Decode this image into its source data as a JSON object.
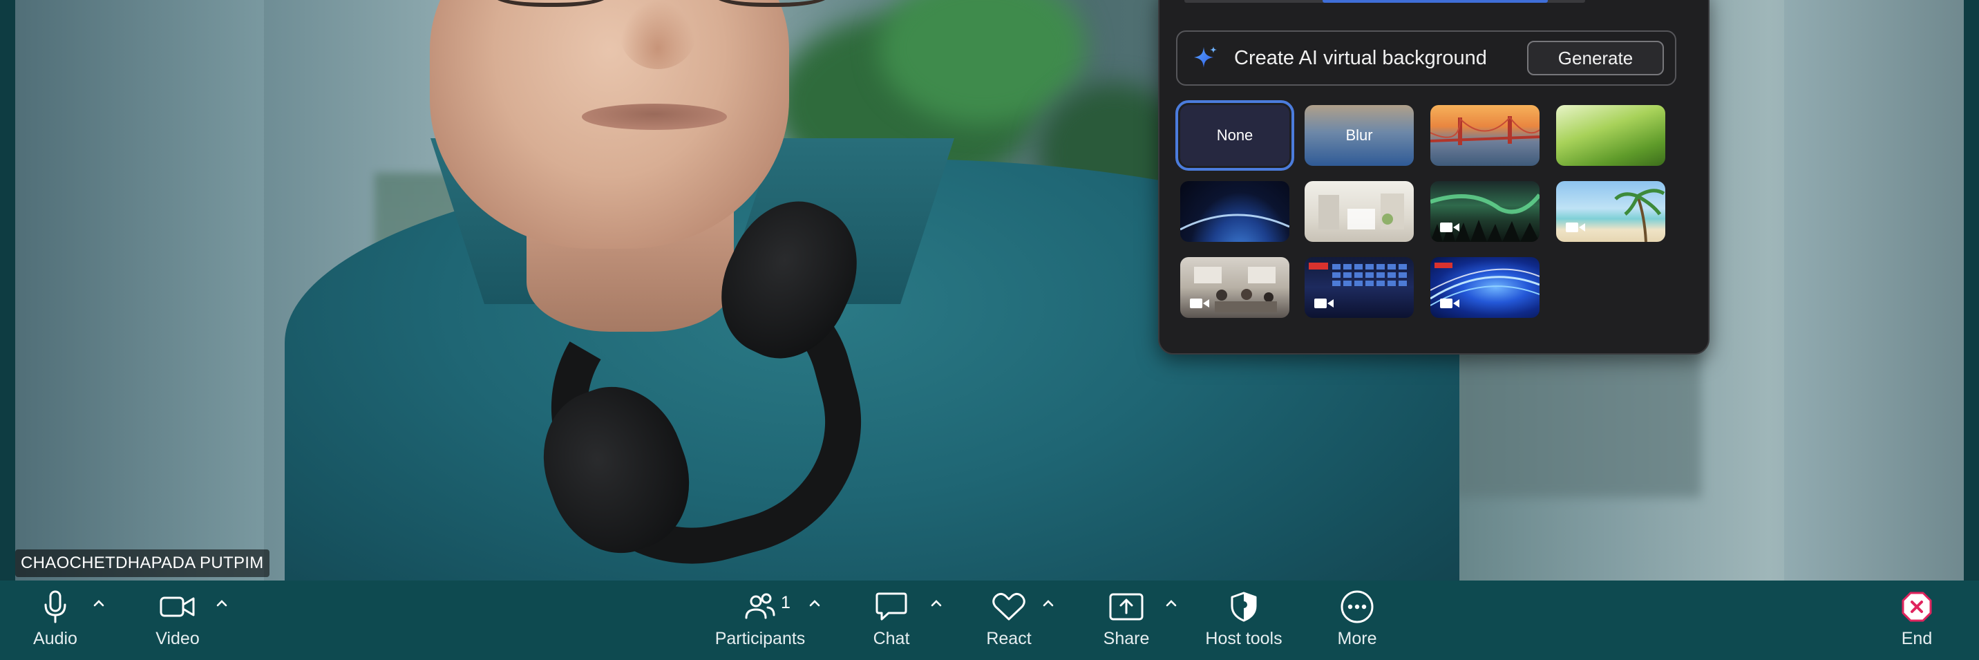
{
  "video": {
    "participant_name": "CHAOCHETDHAPADA PUTPIM"
  },
  "virtual_background_panel": {
    "ai_label": "Create AI virtual background",
    "generate_label": "Generate",
    "thumbnails": [
      {
        "label": "None",
        "selected": true
      },
      {
        "label": "Blur",
        "selected": false
      },
      {
        "label": "",
        "scene": "golden-gate-bridge"
      },
      {
        "label": "",
        "scene": "grass"
      },
      {
        "label": "",
        "scene": "earth-from-space"
      },
      {
        "label": "",
        "scene": "white-office"
      },
      {
        "label": "",
        "scene": "aurora",
        "video": true
      },
      {
        "label": "",
        "scene": "beach-palm",
        "video": true
      },
      {
        "label": "",
        "scene": "meeting-room",
        "video": true
      },
      {
        "label": "",
        "scene": "news-studio",
        "video": true
      },
      {
        "label": "",
        "scene": "blue-light-streaks",
        "video": true
      }
    ]
  },
  "toolbar": {
    "audio": "Audio",
    "video": "Video",
    "participants": "Participants",
    "participants_count": "1",
    "chat": "Chat",
    "react": "React",
    "share": "Share",
    "host_tools": "Host tools",
    "more": "More",
    "end": "End"
  },
  "colors": {
    "toolbar_bg": "#0e4a50",
    "panel_bg": "#1f1f21",
    "selection_accent": "#4b7cdc",
    "end_accent": "#e0245e"
  }
}
